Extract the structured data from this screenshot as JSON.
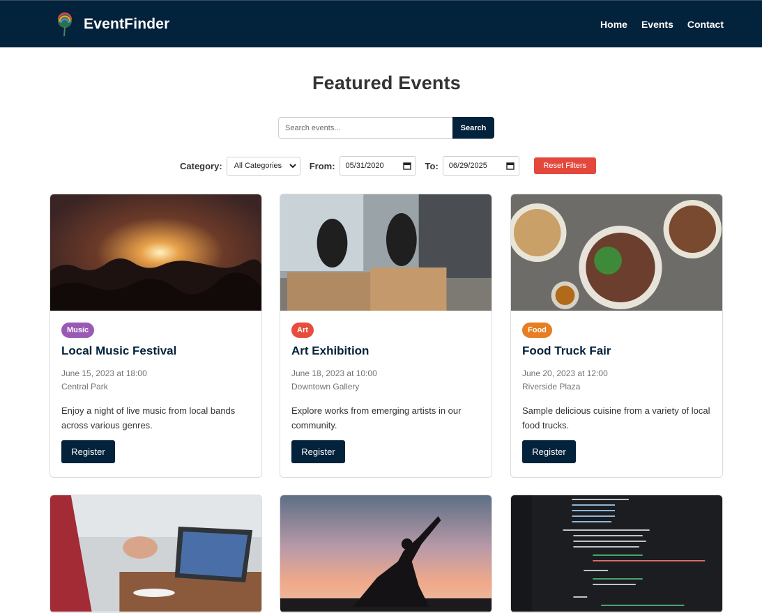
{
  "header": {
    "brand": "EventFinder",
    "nav": [
      "Home",
      "Events",
      "Contact"
    ]
  },
  "page_title": "Featured Events",
  "search": {
    "placeholder": "Search events...",
    "button": "Search"
  },
  "filters": {
    "category_label": "Category:",
    "category_value": "All Categories",
    "from_label": "From:",
    "from_value": "05/31/2020",
    "to_label": "To:",
    "to_value": "06/29/2025",
    "reset": "Reset Filters"
  },
  "cards": [
    {
      "badge": "Music",
      "badge_color": "#9b59b6",
      "title": "Local Music Festival",
      "date": "June 15, 2023 at 18:00",
      "location": "Central Park",
      "description": "Enjoy a night of live music from local bands across various genres.",
      "button": "Register"
    },
    {
      "badge": "Art",
      "badge_color": "#e74c3c",
      "title": "Art Exhibition",
      "date": "June 18, 2023 at 10:00",
      "location": "Downtown Gallery",
      "description": "Explore works from emerging artists in our community.",
      "button": "Register"
    },
    {
      "badge": "Food",
      "badge_color": "#e67e22",
      "title": "Food Truck Fair",
      "date": "June 20, 2023 at 12:00",
      "location": "Riverside Plaza",
      "description": "Sample delicious cuisine from a variety of local food trucks.",
      "button": "Register"
    }
  ],
  "colors": {
    "navy": "#03223b",
    "reset": "#e4473c"
  }
}
